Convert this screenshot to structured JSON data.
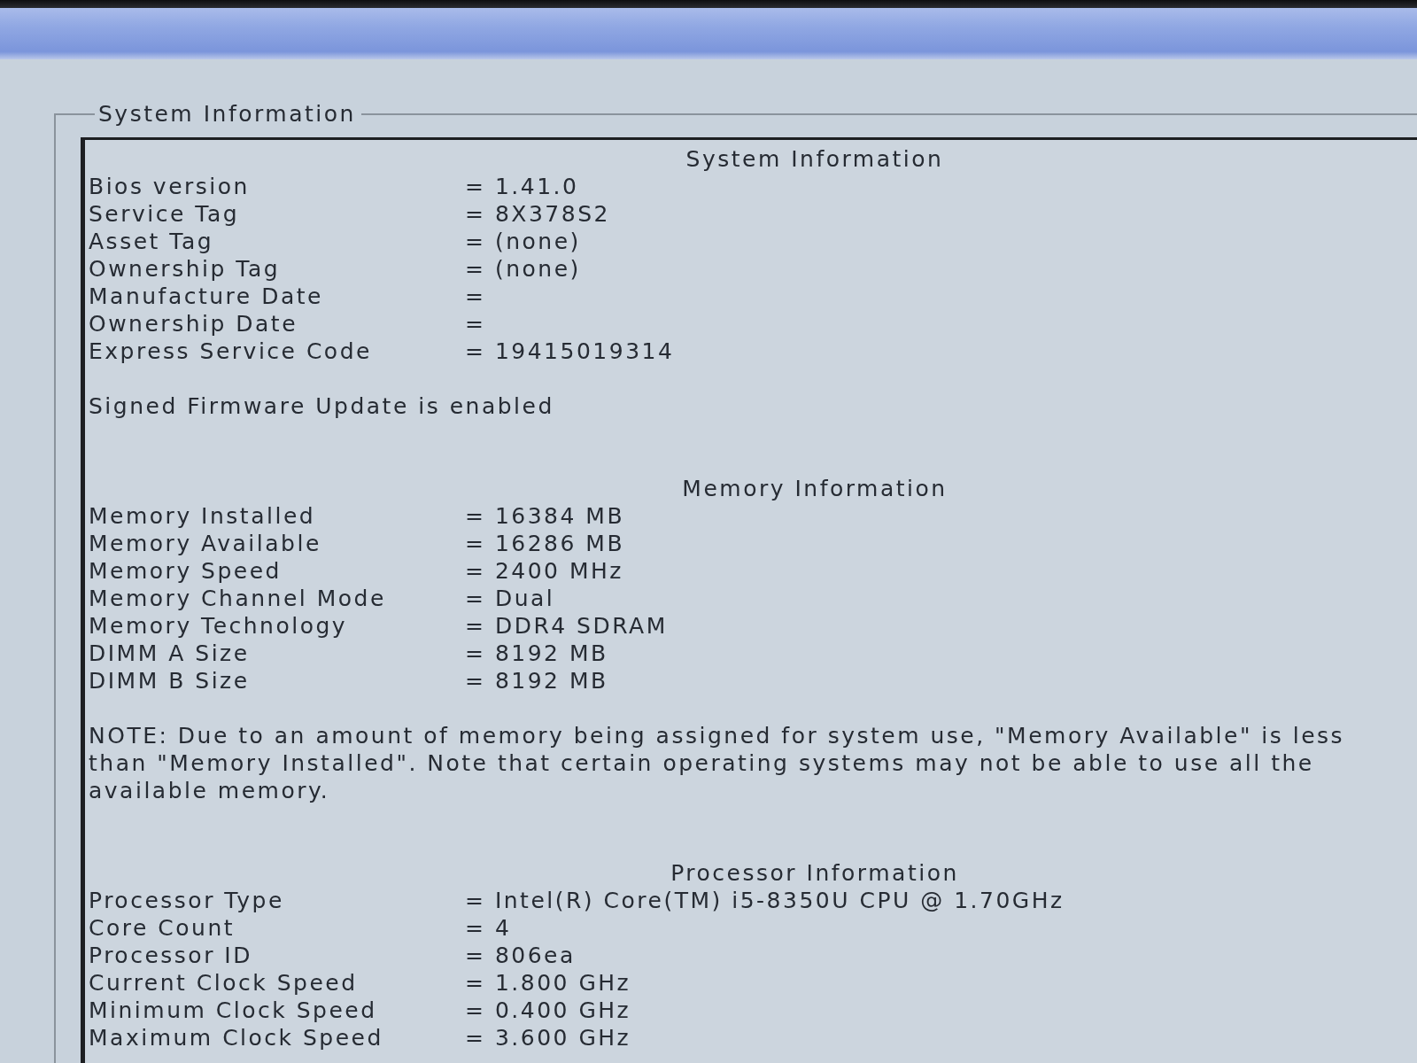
{
  "group_title": "System Information",
  "sections": [
    {
      "title": "System Information",
      "rows": [
        {
          "label": "Bios version",
          "value": "= 1.41.0"
        },
        {
          "label": "Service Tag",
          "value": "= 8X378S2"
        },
        {
          "label": "Asset Tag",
          "value": "= (none)"
        },
        {
          "label": "Ownership Tag",
          "value": "= (none)"
        },
        {
          "label": "Manufacture Date",
          "value": "="
        },
        {
          "label": "Ownership Date",
          "value": "="
        },
        {
          "label": "Express Service Code",
          "value": "= 19415019314"
        }
      ],
      "note": "Signed Firmware Update is enabled"
    },
    {
      "title": "Memory Information",
      "rows": [
        {
          "label": "Memory Installed",
          "value": "= 16384 MB"
        },
        {
          "label": "Memory Available",
          "value": "= 16286 MB"
        },
        {
          "label": "Memory Speed",
          "value": "= 2400 MHz"
        },
        {
          "label": "Memory Channel Mode",
          "value": "= Dual"
        },
        {
          "label": "Memory Technology",
          "value": "= DDR4 SDRAM"
        },
        {
          "label": "DIMM A Size",
          "value": "= 8192 MB"
        },
        {
          "label": "DIMM B Size",
          "value": "= 8192 MB"
        }
      ],
      "note": "NOTE: Due to an amount of memory being assigned for system use, \"Memory Available\" is less than \"Memory Installed\". Note that certain operating systems may not be able to use all the available memory."
    },
    {
      "title": "Processor Information",
      "rows": [
        {
          "label": "Processor Type",
          "value": "= Intel(R) Core(TM) i5-8350U CPU @ 1.70GHz"
        },
        {
          "label": "Core Count",
          "value": "= 4"
        },
        {
          "label": "Processor ID",
          "value": "= 806ea"
        },
        {
          "label": "Current Clock Speed",
          "value": "= 1.800 GHz"
        },
        {
          "label": "Minimum Clock Speed",
          "value": "= 0.400 GHz"
        },
        {
          "label": "Maximum Clock Speed",
          "value": "= 3.600 GHz"
        }
      ]
    }
  ]
}
